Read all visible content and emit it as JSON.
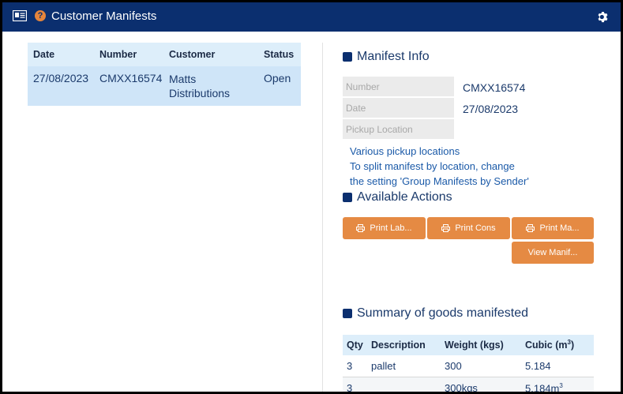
{
  "window": {
    "title": "Customer Manifests"
  },
  "manifests_table": {
    "columns": [
      "Date",
      "Number",
      "Customer",
      "Status"
    ],
    "rows": [
      {
        "date": "27/08/2023",
        "number": "CMXX16574",
        "customer_line1": "Matts",
        "customer_line2": "Distributions",
        "status": "Open"
      }
    ]
  },
  "manifest_info": {
    "heading": "Manifest Info",
    "fields": [
      {
        "label": "Number",
        "value": "CMXX16574"
      },
      {
        "label": "Date",
        "value": "27/08/2023"
      },
      {
        "label": "Pickup Location",
        "value": ""
      }
    ],
    "note_lines": [
      "Various pickup locations",
      "To split manifest by location, change",
      "the setting 'Group Manifests by Sender'"
    ]
  },
  "actions": {
    "heading": "Available Actions",
    "buttons": [
      "Print Lab...",
      "Print Cons",
      "Print Ma...",
      "View Manif..."
    ]
  },
  "summary": {
    "heading": "Summary of goods manifested",
    "columns": {
      "qty": "Qty",
      "description": "Description",
      "weight": "Weight (kgs)",
      "cubic": "Cubic (m",
      "cubic_sup": "3",
      "cubic_close": ")"
    },
    "rows": [
      {
        "qty": "3",
        "description": "pallet",
        "weight": "300",
        "cubic": "5.184",
        "cubic_unit": "",
        "cubic_sup": ""
      },
      {
        "qty": "3",
        "description": "",
        "weight": "300kgs",
        "cubic": "5.184",
        "cubic_unit": "m",
        "cubic_sup": "3"
      }
    ]
  },
  "colors": {
    "titlebar": "#0b2f6f",
    "accent": "#e58a43",
    "row_selected": "#cfe5f8",
    "header_bg": "#ddeefa"
  },
  "icons": {
    "app": "manifest-card-icon",
    "help": "help-circle-icon",
    "settings": "gear-icon",
    "print": "printer-icon"
  }
}
